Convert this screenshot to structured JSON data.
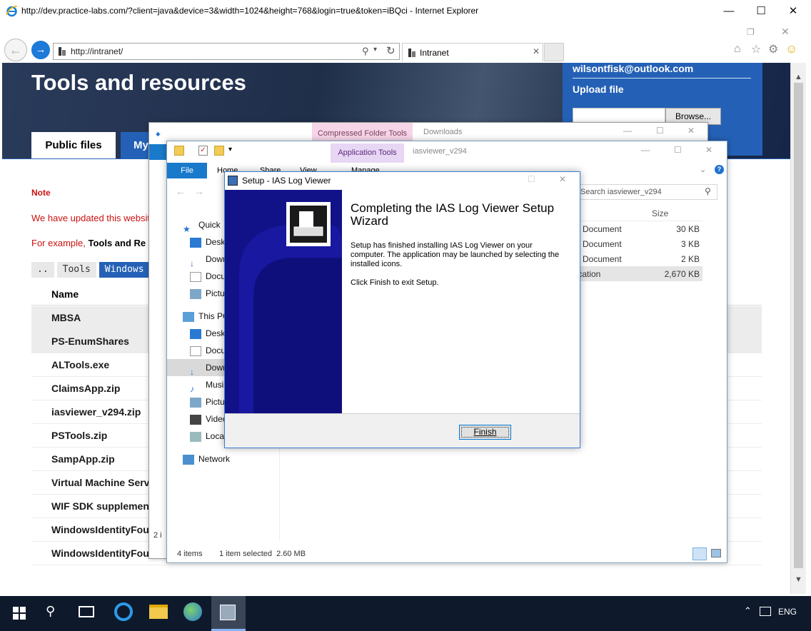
{
  "ie": {
    "title": "http://dev.practice-labs.com/?client=java&device=3&width=1024&height=768&login=true&token=iBQci - Internet Explorer",
    "address": "http://intranet/",
    "tab_label": "Intranet"
  },
  "page": {
    "heading": "Tools and resources",
    "account_email": "wilsontfisk@outlook.com",
    "upload_label": "Upload file",
    "browse_label": "Browse...",
    "tabs": [
      "Public files",
      "My"
    ],
    "note_label": "Note",
    "note_text": "We have updated this websit",
    "example_prefix": "For example,",
    "example_bold": "Tools and Re",
    "breadcrumb": [
      "..",
      "Tools",
      "Windows"
    ],
    "name_header": "Name",
    "files": [
      "MBSA",
      "PS-EnumShares",
      "ALTools.exe",
      "ClaimsApp.zip",
      "iasviewer_v294.zip",
      "PSTools.zip",
      "SampApp.zip",
      "Virtual Machine Servi",
      "WIF SDK supplementa",
      "WindowsIdentityFoun",
      "WindowsIdentityFoundati"
    ]
  },
  "explorer_back": {
    "context_tab": "Compressed Folder Tools",
    "title": "Downloads",
    "status": "2 i"
  },
  "explorer_front": {
    "context_tab": "Application Tools",
    "title": "iasviewer_v294",
    "ribbon_tabs": [
      "File",
      "Home",
      "Share",
      "View",
      "Manage"
    ],
    "search_placeholder": "Search iasviewer_v294",
    "nav_items": [
      {
        "label": "Quick",
        "icon": "star-icon"
      },
      {
        "label": "Deskt",
        "icon": "desktop-icon"
      },
      {
        "label": "Down",
        "icon": "download-icon"
      },
      {
        "label": "Docu",
        "icon": "document-icon"
      },
      {
        "label": "Pictu",
        "icon": "picture-icon"
      },
      {
        "label": "This PC",
        "icon": "computer-icon"
      },
      {
        "label": "Deskt",
        "icon": "desktop-icon"
      },
      {
        "label": "Docu",
        "icon": "document-icon"
      },
      {
        "label": "Down",
        "icon": "download-icon"
      },
      {
        "label": "Musi",
        "icon": "music-icon"
      },
      {
        "label": "Pictu",
        "icon": "picture-icon"
      },
      {
        "label": "Video",
        "icon": "video-icon"
      },
      {
        "label": "Local",
        "icon": "drive-icon"
      },
      {
        "label": "Network",
        "icon": "network-icon"
      }
    ],
    "columns": [
      "e",
      "Size"
    ],
    "rows": [
      {
        "type": "Document",
        "size": "30 KB"
      },
      {
        "type": "Document",
        "size": "3 KB"
      },
      {
        "type": "Document",
        "size": "2 KB"
      },
      {
        "type": "lication",
        "size": "2,670 KB"
      }
    ],
    "status_items": "4 items",
    "status_selected": "1 item selected  2.60 MB"
  },
  "setup": {
    "window_title": "Setup - IAS Log Viewer",
    "heading": "Completing the IAS Log Viewer Setup Wizard",
    "body1": "Setup has finished installing IAS Log Viewer on your computer. The application may be launched by selecting the installed icons.",
    "body2": "Click Finish to exit Setup.",
    "finish_label": "Finish"
  },
  "taskbar": {
    "language": "ENG"
  },
  "colors": {
    "accent": "#2461b6",
    "note_red": "#cc1111",
    "taskbar": "#0e1a2b",
    "setup_side": "#1a1a9a"
  }
}
